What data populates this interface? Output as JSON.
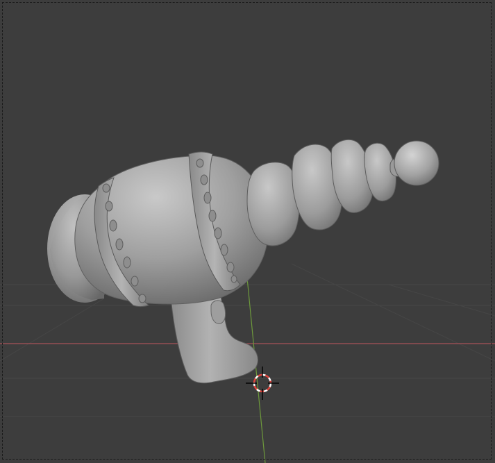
{
  "viewport": {
    "label": "3D Viewport",
    "background": "#3d3d3d",
    "colors": {
      "grid_line": "#474747",
      "axis_x": "#a8525a",
      "axis_y": "#6e9a3c",
      "model_base": "#9a9a9a",
      "model_highlight": "#d2d2d2",
      "model_shadow": "#5c5c5c",
      "cursor_red": "#e0443c",
      "cursor_white": "#ffffff"
    },
    "objects": [
      {
        "name": "ray-gun-model",
        "type": "mesh"
      },
      {
        "name": "3d-cursor",
        "type": "cursor"
      }
    ]
  }
}
